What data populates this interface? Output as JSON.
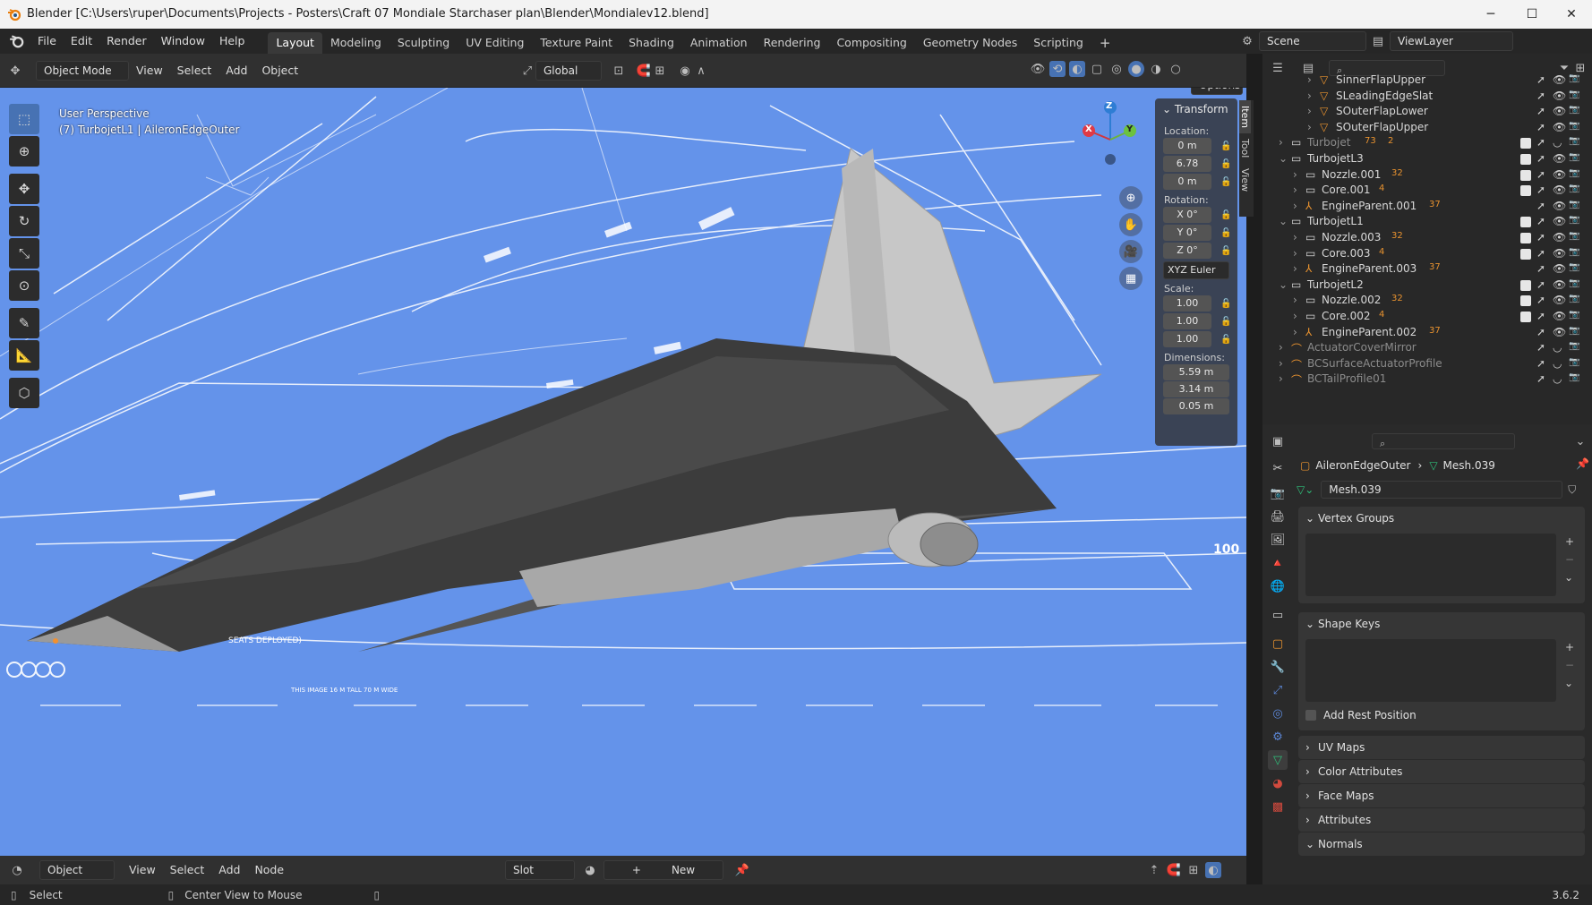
{
  "window": {
    "title": "Blender [C:\\Users\\ruper\\Documents\\Projects - Posters\\Craft 07 Mondiale Starchaser plan\\Blender\\Mondialev12.blend]",
    "minimize": "─",
    "maximize": "☐",
    "close": "✕"
  },
  "menu": [
    "File",
    "Edit",
    "Render",
    "Window",
    "Help"
  ],
  "workspaces": [
    {
      "label": "Layout",
      "active": true
    },
    {
      "label": "Modeling"
    },
    {
      "label": "Sculpting"
    },
    {
      "label": "UV Editing"
    },
    {
      "label": "Texture Paint"
    },
    {
      "label": "Shading"
    },
    {
      "label": "Animation"
    },
    {
      "label": "Rendering"
    },
    {
      "label": "Compositing"
    },
    {
      "label": "Geometry Nodes"
    },
    {
      "label": "Scripting"
    }
  ],
  "add_workspace": "+",
  "scene": {
    "label": "Scene",
    "view_layer": "ViewLayer"
  },
  "viewport_header": {
    "mode": "Object Mode",
    "menus": [
      "View",
      "Select",
      "Add",
      "Object"
    ],
    "orientation": "Global",
    "options": "Options"
  },
  "viewport": {
    "perspective": "User Perspective",
    "object_info": "(7) TurbojetL1 | AileronEdgeOuter",
    "gizmo_axes": {
      "z": "Z",
      "x": "X",
      "y": "Y"
    },
    "blueprint_text": [
      "SEATS DEPLOYED)",
      "THIS IMAGE 16 M TALL 70 M WIDE",
      "100"
    ]
  },
  "npanel": {
    "header": "Transform",
    "tabs": [
      "Item",
      "Tool",
      "View"
    ],
    "location_label": "Location:",
    "location": [
      "0 m",
      "6.78",
      "0 m"
    ],
    "rotation_label": "Rotation:",
    "rotation": [
      "X  0°",
      "Y  0°",
      "Z  0°"
    ],
    "rotation_mode": "XYZ Euler",
    "scale_label": "Scale:",
    "scale": [
      "1.00",
      "1.00",
      "1.00"
    ],
    "dimensions_label": "Dimensions:",
    "dimensions": [
      "5.59 m",
      "3.14 m",
      "0.05 m"
    ]
  },
  "outliner": {
    "rows": [
      {
        "name": "SinnerFlapUpper",
        "indent": 3,
        "icon": "mesh"
      },
      {
        "name": "SLeadingEdgeSlat",
        "indent": 3,
        "icon": "mesh"
      },
      {
        "name": "SOuterFlapLower",
        "indent": 3,
        "icon": "mesh"
      },
      {
        "name": "SOuterFlapUpper",
        "indent": 3,
        "icon": "mesh"
      },
      {
        "name": "Turbojet",
        "indent": 1,
        "icon": "collection",
        "dim": true,
        "badges": [
          "73",
          "2"
        ]
      },
      {
        "name": "TurbojetL3",
        "indent": 1,
        "icon": "collection",
        "open": true
      },
      {
        "name": "Nozzle.001",
        "indent": 2,
        "icon": "collection",
        "badges": [
          "32"
        ]
      },
      {
        "name": "Core.001",
        "indent": 2,
        "icon": "collection",
        "badges": [
          "4"
        ]
      },
      {
        "name": "EngineParent.001",
        "indent": 2,
        "icon": "empty",
        "badges": [
          "37"
        ]
      },
      {
        "name": "TurbojetL1",
        "indent": 1,
        "icon": "collection",
        "open": true
      },
      {
        "name": "Nozzle.003",
        "indent": 2,
        "icon": "collection",
        "badges": [
          "32"
        ]
      },
      {
        "name": "Core.003",
        "indent": 2,
        "icon": "collection",
        "badges": [
          "4"
        ]
      },
      {
        "name": "EngineParent.003",
        "indent": 2,
        "icon": "empty",
        "badges": [
          "37"
        ]
      },
      {
        "name": "TurbojetL2",
        "indent": 1,
        "icon": "collection",
        "open": true
      },
      {
        "name": "Nozzle.002",
        "indent": 2,
        "icon": "collection",
        "badges": [
          "32"
        ]
      },
      {
        "name": "Core.002",
        "indent": 2,
        "icon": "collection",
        "badges": [
          "4"
        ]
      },
      {
        "name": "EngineParent.002",
        "indent": 2,
        "icon": "empty",
        "badges": [
          "37"
        ]
      },
      {
        "name": "ActuatorCoverMirror",
        "indent": 1,
        "icon": "curve",
        "dim": true
      },
      {
        "name": "BCSurfaceActuatorProfile",
        "indent": 1,
        "icon": "curve",
        "dim": true
      },
      {
        "name": "BCTailProfile01",
        "indent": 1,
        "icon": "curve",
        "dim": true
      }
    ]
  },
  "properties": {
    "breadcrumb_object": "AileronEdgeOuter",
    "breadcrumb_mesh": "Mesh.039",
    "mesh_name": "Mesh.039",
    "panels": {
      "vertex_groups": "Vertex Groups",
      "shape_keys": "Shape Keys",
      "add_rest_position": "Add Rest Position",
      "uv_maps": "UV Maps",
      "color_attributes": "Color Attributes",
      "face_maps": "Face Maps",
      "attributes": "Attributes",
      "normals": "Normals"
    }
  },
  "bottom_header": {
    "mode": "Object",
    "menus": [
      "View",
      "Select",
      "Add",
      "Node"
    ],
    "slot": "Slot",
    "new": "New"
  },
  "status": {
    "select": "Select",
    "center_view": "Center View to Mouse",
    "version": "3.6.2"
  },
  "colors": {
    "viewport_bg": "#6493ea",
    "active_tool": "#4772b3",
    "accent_blue": "#4772b3"
  }
}
